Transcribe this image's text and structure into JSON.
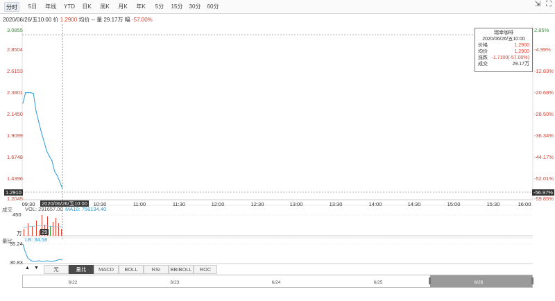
{
  "tabs": [
    {
      "label": "分时",
      "active": true
    },
    {
      "label": "5日"
    },
    {
      "label": "年线"
    },
    {
      "label": "YTD"
    },
    {
      "label": "日K"
    },
    {
      "label": "周K"
    },
    {
      "label": "月K"
    },
    {
      "label": "年K"
    },
    {
      "label": "5分"
    },
    {
      "label": "15分"
    },
    {
      "label": "30分"
    },
    {
      "label": "60分"
    }
  ],
  "toolbar_icons": [
    "compress-icon",
    "expand-icon"
  ],
  "info": {
    "datetime": "2020/06/26/五10:00",
    "price_label": "价",
    "price": "1.2900",
    "avg_label": "均价",
    "avg": "--",
    "volume_label": "量",
    "volume": "29.17万",
    "change_label": "幅",
    "change": "-57.00%"
  },
  "price_axis": {
    "left": [
      "3.0855",
      "2.8504",
      "2.6153",
      "2.3801",
      "2.1450",
      "1.9099",
      "1.6748",
      "1.4396",
      "1.2910",
      "1.2045"
    ],
    "right": [
      "2.85%",
      "-4.99%",
      "-12.83%",
      "-20.68%",
      "-28.50%",
      "-36.34%",
      "-44.17%",
      "-52.01%",
      "-56.97%",
      "-59.85%"
    ]
  },
  "time_axis": [
    "09:30",
    "10:30",
    "11:00",
    "11:30",
    "12:00",
    "12:30",
    "13:00",
    "13:30",
    "14:00",
    "14:30",
    "15:00",
    "15:30",
    "16:00"
  ],
  "cursor_time": "2020/06/26/五10:00",
  "tooltip": {
    "title": "瑞幸咖啡",
    "date": "2020/06/26/五10:00",
    "rows": [
      {
        "label": "价格",
        "value": "1.2900",
        "color": "#e23b2a"
      },
      {
        "label": "均价",
        "value": "1.2900",
        "color": "#e23b2a"
      },
      {
        "label": "涨跌",
        "value": "-1.7100(-57.00%)",
        "color": "#e23b2a"
      },
      {
        "label": "成交",
        "value": "29.17万",
        "color": "#222222"
      }
    ]
  },
  "volume_panel": {
    "side_label": "成交",
    "legend_vol": "VOL: 291657.00",
    "legend_ma": "MA10: 756134.40",
    "max": "450",
    "unit": "万",
    "cursor_value": "29"
  },
  "lb_panel": {
    "side_label": "量比",
    "legend": "LB: 34.58",
    "top": "55.24",
    "bottom": "30.83"
  },
  "indicator_tabs": [
    {
      "label": "无"
    },
    {
      "label": "量比",
      "active": true
    },
    {
      "label": "MACD"
    },
    {
      "label": "BOLL"
    },
    {
      "label": "RSI"
    },
    {
      "label": "BBIBOLL"
    },
    {
      "label": "ROC"
    }
  ],
  "indicator_arrows": [
    "▲",
    "▼"
  ],
  "navigator_dates": [
    "6/22",
    "6/23",
    "6/24",
    "6/25",
    "6/26"
  ],
  "colors": {
    "up": "#2b9b2b",
    "down": "#e23b2a",
    "line": "#2a9bd4",
    "accent": "#1e88e5"
  },
  "chart_data": {
    "type": "line",
    "title": "",
    "x": [
      "09:30",
      "09:32",
      "09:34",
      "09:36",
      "09:38",
      "09:40",
      "09:42",
      "09:44",
      "09:46",
      "09:48",
      "09:50",
      "09:52",
      "09:54",
      "09:56",
      "09:58",
      "10:00"
    ],
    "series": [
      {
        "values": [
          2.26,
          2.38,
          2.38,
          2.38,
          2.37,
          2.17,
          2.05,
          1.93,
          1.83,
          1.72,
          1.66,
          1.61,
          1.49,
          1.44,
          1.37,
          1.29
        ]
      }
    ],
    "ylim": [
      1.2045,
      3.0855
    ]
  }
}
